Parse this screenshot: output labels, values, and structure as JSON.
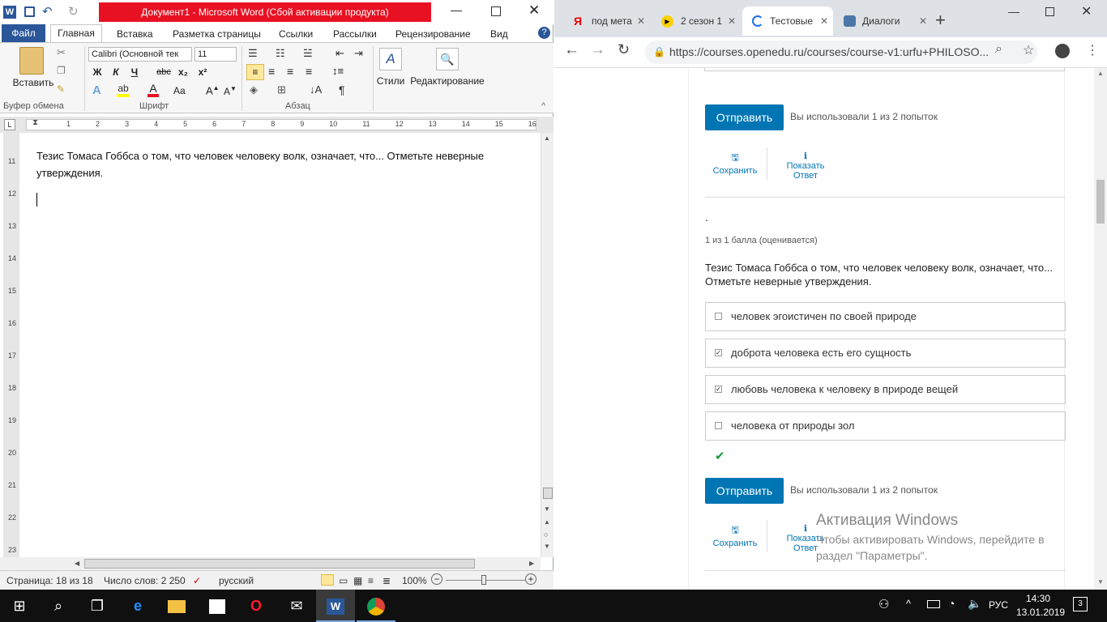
{
  "word": {
    "window_title": "Документ1  -  Microsoft Word (Сбой активации продукта)",
    "tabs": [
      "Файл",
      "Главная",
      "Вставка",
      "Разметка страницы",
      "Ссылки",
      "Рассылки",
      "Рецензирование",
      "Вид"
    ],
    "paste_label": "Вставить",
    "groups": [
      "Буфер обмена",
      "Шрифт",
      "Абзац"
    ],
    "font_name": "Calibri (Основной тек",
    "font_size": "11",
    "format_buttons": [
      "Ж",
      "К",
      "Ч",
      "abc",
      "x₂",
      "x²"
    ],
    "styles_label": "Стили",
    "editing_label": "Редактирование",
    "document_text": "Тезис Томаса Гоббса о том, что человек человеку волк, означает, что... Отметьте неверные утверждения.",
    "status": {
      "page": "Страница: 18 из 18",
      "words": "Число слов: 2 250",
      "language": "русский",
      "zoom": "100%"
    },
    "ruler_numbers": [
      "1",
      "2",
      "3",
      "4",
      "5",
      "6",
      "7",
      "8",
      "9",
      "10",
      "11",
      "12",
      "13",
      "14",
      "15",
      "16"
    ],
    "vruler_numbers": [
      "11",
      "12",
      "13",
      "14",
      "15",
      "16",
      "17",
      "18",
      "19",
      "20",
      "21",
      "22",
      "23"
    ]
  },
  "chrome": {
    "tabs": [
      {
        "label": "под мета",
        "icon": "yandex-icon"
      },
      {
        "label": "2 сезон 1",
        "icon": "play-icon"
      },
      {
        "label": "Тестовые",
        "icon": "loading-icon"
      },
      {
        "label": "Диалоги",
        "icon": "chat-icon"
      }
    ],
    "url": "https://courses.openedu.ru/courses/course-v1:urfu+PHILOSO...",
    "page": {
      "submit_label": "Отправить",
      "attempts": "Вы использовали 1 из 2 попыток",
      "save_label": "Сохранить",
      "show_answer_label": "Показать Ответ",
      "dot": ".",
      "score": "1 из 1 балла (оценивается)",
      "question": "Тезис Томаса Гоббса о том, что человек человеку волк, означает, что... Отметьте неверные утверждения.",
      "options": [
        {
          "text": "человек эгоистичен по своей природе",
          "checked": false
        },
        {
          "text": "доброта человека есть его сущность",
          "checked": true
        },
        {
          "text": "любовь человека к человеку в природе вещей",
          "checked": true
        },
        {
          "text": "человека от природы зол",
          "checked": false
        }
      ],
      "check_mark": "✔",
      "submit_label_2": "Отправить",
      "attempts_2": "Вы использовали 1 из 2 попыток",
      "save_label_2": "Сохранить",
      "show_answer_label_2": "Показать Ответ"
    },
    "watermark_title": "Активация Windows",
    "watermark_text": "Чтобы активировать Windows, перейдите в раздел \"Параметры\"."
  },
  "taskbar": {
    "lang": "РУС",
    "time": "14:30",
    "date": "13.01.2019",
    "notifications": "3"
  },
  "colors": {
    "word_blue": "#2b579a",
    "title_red": "#e81123",
    "edx_blue": "#0075b4",
    "check_green": "#1a9b3a"
  }
}
